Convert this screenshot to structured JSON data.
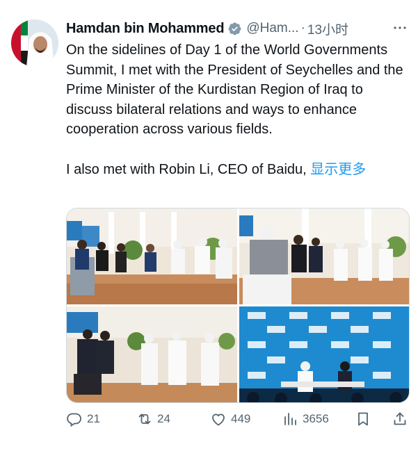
{
  "tweet": {
    "author_name": "Hamdan bin Mohammed",
    "handle": "@Ham...",
    "separator": "·",
    "time": "13小时",
    "body_paragraph_1": "On the sidelines of Day 1 of the World Governments Summit, I met with the President of Seychelles and the Prime Minister of the Kurdistan Region of Iraq to discuss bilateral relations and ways to enhance cooperation across various fields.",
    "body_paragraph_2": "I also met with Robin Li, CEO of Baidu, ",
    "show_more": "显示更多",
    "icons": {
      "verified": "verified-badge-icon",
      "more": "more-options-icon",
      "reply": "reply-icon",
      "retweet": "retweet-icon",
      "like": "like-icon",
      "views": "views-icon",
      "bookmark": "bookmark-icon",
      "share": "share-icon"
    },
    "media_alt": [
      "meeting-photo-1",
      "meeting-photo-2",
      "meeting-photo-3",
      "meeting-photo-4"
    ],
    "stats": {
      "replies": "21",
      "retweets": "24",
      "likes": "449",
      "views": "3656"
    },
    "colors": {
      "text": "#0f1419",
      "secondary": "#536471",
      "link": "#1d9bf0",
      "verified_badge": "#829aab"
    }
  }
}
